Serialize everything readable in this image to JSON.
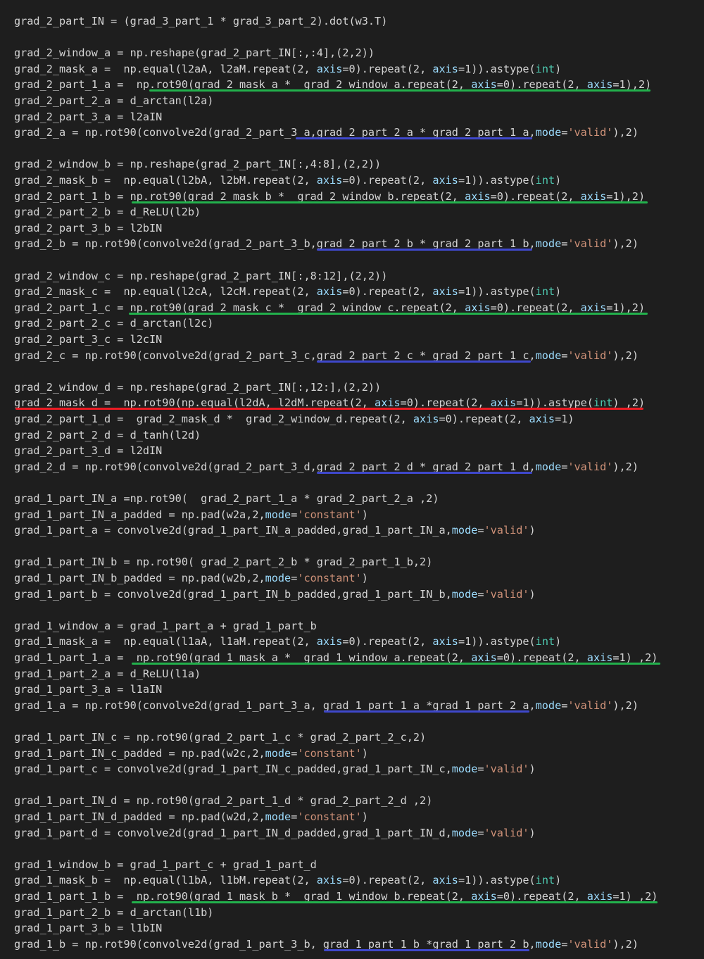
{
  "editor": {
    "colors": {
      "background": "#1e1e1e",
      "text": "#d4d4d4",
      "keyword_arg": "#9cdcfe",
      "string": "#ce9178",
      "number": "#b5cea8",
      "type": "#4ec9b0",
      "underline_green": "#22b14c",
      "underline_blue": "#3f48cc",
      "underline_red": "#ed1c24"
    },
    "lines": [
      [
        [
          "p",
          "grad_2_part_IN = (grad_3_part_1 * grad_3_part_2).dot(w3.T)"
        ]
      ],
      [],
      [
        [
          "p",
          "grad_2_window_a = np.reshape(grad_2_part_IN[:,:4],(2,2))"
        ]
      ],
      [
        [
          "p",
          "grad_2_mask_a =  np.equal(l2aA, l2aM.repeat(2, "
        ],
        [
          "kw",
          "axis"
        ],
        [
          "p",
          "=0).repeat(2, "
        ],
        [
          "kw",
          "axis"
        ],
        [
          "p",
          "=1)).astype("
        ],
        [
          "type",
          "int"
        ],
        [
          "p",
          ")"
        ]
      ],
      [
        [
          "p",
          "grad_2_part_1_a =  np.rot90(grad_2_mask_a *  grad_2_window_a.repeat(2, "
        ],
        [
          "kw",
          "axis"
        ],
        [
          "p",
          "=0).repeat(2, "
        ],
        [
          "kw",
          "axis"
        ],
        [
          "p",
          "=1),2)"
        ]
      ],
      [
        [
          "p",
          "grad_2_part_2_a = d_arctan(l2a)"
        ]
      ],
      [
        [
          "p",
          "grad_2_part_3_a = l2aIN"
        ]
      ],
      [
        [
          "p",
          "grad_2_a = np.rot90(convolve2d(grad_2_part_3_a,grad_2_part_2_a * grad_2_part_1_a,"
        ],
        [
          "kw",
          "mode"
        ],
        [
          "p",
          "="
        ],
        [
          "str",
          "'valid'"
        ],
        [
          "p",
          "),2)"
        ]
      ],
      [],
      [
        [
          "p",
          "grad_2_window_b = np.reshape(grad_2_part_IN[:,4:8],(2,2))"
        ]
      ],
      [
        [
          "p",
          "grad_2_mask_b =  np.equal(l2bA, l2bM.repeat(2, "
        ],
        [
          "kw",
          "axis"
        ],
        [
          "p",
          "=0).repeat(2, "
        ],
        [
          "kw",
          "axis"
        ],
        [
          "p",
          "=1)).astype("
        ],
        [
          "type",
          "int"
        ],
        [
          "p",
          ")"
        ]
      ],
      [
        [
          "p",
          "grad_2_part_1_b = np.rot90(grad_2_mask_b *  grad_2_window_b.repeat(2, "
        ],
        [
          "kw",
          "axis"
        ],
        [
          "p",
          "=0).repeat(2, "
        ],
        [
          "kw",
          "axis"
        ],
        [
          "p",
          "=1),2)"
        ]
      ],
      [
        [
          "p",
          "grad_2_part_2_b = d_ReLU(l2b)"
        ]
      ],
      [
        [
          "p",
          "grad_2_part_3_b = l2bIN"
        ]
      ],
      [
        [
          "p",
          "grad_2_b = np.rot90(convolve2d(grad_2_part_3_b,grad_2_part_2_b * grad_2_part_1_b,"
        ],
        [
          "kw",
          "mode"
        ],
        [
          "p",
          "="
        ],
        [
          "str",
          "'valid'"
        ],
        [
          "p",
          "),2)"
        ]
      ],
      [],
      [
        [
          "p",
          "grad_2_window_c = np.reshape(grad_2_part_IN[:,8:12],(2,2))"
        ]
      ],
      [
        [
          "p",
          "grad_2_mask_c =  np.equal(l2cA, l2cM.repeat(2, "
        ],
        [
          "kw",
          "axis"
        ],
        [
          "p",
          "=0).repeat(2, "
        ],
        [
          "kw",
          "axis"
        ],
        [
          "p",
          "=1)).astype("
        ],
        [
          "type",
          "int"
        ],
        [
          "p",
          ")"
        ]
      ],
      [
        [
          "p",
          "grad_2_part_1_c = np.rot90(grad_2_mask_c *  grad_2_window_c.repeat(2, "
        ],
        [
          "kw",
          "axis"
        ],
        [
          "p",
          "=0).repeat(2, "
        ],
        [
          "kw",
          "axis"
        ],
        [
          "p",
          "=1),2)"
        ]
      ],
      [
        [
          "p",
          "grad_2_part_2_c = d_arctan(l2c)"
        ]
      ],
      [
        [
          "p",
          "grad_2_part_3_c = l2cIN"
        ]
      ],
      [
        [
          "p",
          "grad_2_c = np.rot90(convolve2d(grad_2_part_3_c,grad_2_part_2_c * grad_2_part_1_c,"
        ],
        [
          "kw",
          "mode"
        ],
        [
          "p",
          "="
        ],
        [
          "str",
          "'valid'"
        ],
        [
          "p",
          "),2)"
        ]
      ],
      [],
      [
        [
          "p",
          "grad_2_window_d = np.reshape(grad_2_part_IN[:,12:],(2,2))"
        ]
      ],
      [
        [
          "p",
          "grad_2_mask_d =  np.rot90(np.equal(l2dA, l2dM.repeat(2, "
        ],
        [
          "kw",
          "axis"
        ],
        [
          "p",
          "=0).repeat(2, "
        ],
        [
          "kw",
          "axis"
        ],
        [
          "p",
          "=1)).astype("
        ],
        [
          "type",
          "int"
        ],
        [
          "p",
          ") ,2)"
        ]
      ],
      [
        [
          "p",
          "grad_2_part_1_d =  grad_2_mask_d *  grad_2_window_d.repeat(2, "
        ],
        [
          "kw",
          "axis"
        ],
        [
          "p",
          "=0).repeat(2, "
        ],
        [
          "kw",
          "axis"
        ],
        [
          "p",
          "=1)"
        ]
      ],
      [
        [
          "p",
          "grad_2_part_2_d = d_tanh(l2d)"
        ]
      ],
      [
        [
          "p",
          "grad_2_part_3_d = l2dIN"
        ]
      ],
      [
        [
          "p",
          "grad_2_d = np.rot90(convolve2d(grad_2_part_3_d,grad_2_part_2_d * grad_2_part_1_d,"
        ],
        [
          "kw",
          "mode"
        ],
        [
          "p",
          "="
        ],
        [
          "str",
          "'valid'"
        ],
        [
          "p",
          "),2)"
        ]
      ],
      [],
      [
        [
          "p",
          "grad_1_part_IN_a =np.rot90(  grad_2_part_1_a * grad_2_part_2_a ,2)"
        ]
      ],
      [
        [
          "p",
          "grad_1_part_IN_a_padded = np.pad(w2a,2,"
        ],
        [
          "kw",
          "mode"
        ],
        [
          "p",
          "="
        ],
        [
          "str",
          "'constant'"
        ],
        [
          "p",
          ")"
        ]
      ],
      [
        [
          "p",
          "grad_1_part_a = convolve2d(grad_1_part_IN_a_padded,grad_1_part_IN_a,"
        ],
        [
          "kw",
          "mode"
        ],
        [
          "p",
          "="
        ],
        [
          "str",
          "'valid'"
        ],
        [
          "p",
          ")"
        ]
      ],
      [],
      [
        [
          "p",
          "grad_1_part_IN_b = np.rot90( grad_2_part_2_b * grad_2_part_1_b,2)"
        ]
      ],
      [
        [
          "p",
          "grad_1_part_IN_b_padded = np.pad(w2b,2,"
        ],
        [
          "kw",
          "mode"
        ],
        [
          "p",
          "="
        ],
        [
          "str",
          "'constant'"
        ],
        [
          "p",
          ")"
        ]
      ],
      [
        [
          "p",
          "grad_1_part_b = convolve2d(grad_1_part_IN_b_padded,grad_1_part_IN_b,"
        ],
        [
          "kw",
          "mode"
        ],
        [
          "p",
          "="
        ],
        [
          "str",
          "'valid'"
        ],
        [
          "p",
          ")"
        ]
      ],
      [],
      [
        [
          "p",
          "grad_1_window_a = grad_1_part_a + grad_1_part_b"
        ]
      ],
      [
        [
          "p",
          "grad_1_mask_a =  np.equal(l1aA, l1aM.repeat(2, "
        ],
        [
          "kw",
          "axis"
        ],
        [
          "p",
          "=0).repeat(2, "
        ],
        [
          "kw",
          "axis"
        ],
        [
          "p",
          "=1)).astype("
        ],
        [
          "type",
          "int"
        ],
        [
          "p",
          ")"
        ]
      ],
      [
        [
          "p",
          "grad_1_part_1_a =  np.rot90(grad_1_mask_a *  grad_1_window_a.repeat(2, "
        ],
        [
          "kw",
          "axis"
        ],
        [
          "p",
          "=0).repeat(2, "
        ],
        [
          "kw",
          "axis"
        ],
        [
          "p",
          "=1) ,2)"
        ]
      ],
      [
        [
          "p",
          "grad_1_part_2_a = d_ReLU(l1a)"
        ]
      ],
      [
        [
          "p",
          "grad_1_part_3_a = l1aIN"
        ]
      ],
      [
        [
          "p",
          "grad_1_a = np.rot90(convolve2d(grad_1_part_3_a, grad_1_part_1_a *grad_1_part_2_a,"
        ],
        [
          "kw",
          "mode"
        ],
        [
          "p",
          "="
        ],
        [
          "str",
          "'valid'"
        ],
        [
          "p",
          "),2)"
        ]
      ],
      [],
      [
        [
          "p",
          "grad_1_part_IN_c = np.rot90(grad_2_part_1_c * grad_2_part_2_c,2)"
        ]
      ],
      [
        [
          "p",
          "grad_1_part_IN_c_padded = np.pad(w2c,2,"
        ],
        [
          "kw",
          "mode"
        ],
        [
          "p",
          "="
        ],
        [
          "str",
          "'constant'"
        ],
        [
          "p",
          ")"
        ]
      ],
      [
        [
          "p",
          "grad_1_part_c = convolve2d(grad_1_part_IN_c_padded,grad_1_part_IN_c,"
        ],
        [
          "kw",
          "mode"
        ],
        [
          "p",
          "="
        ],
        [
          "str",
          "'valid'"
        ],
        [
          "p",
          ")"
        ]
      ],
      [],
      [
        [
          "p",
          "grad_1_part_IN_d = np.rot90(grad_2_part_1_d * grad_2_part_2_d ,2)"
        ]
      ],
      [
        [
          "p",
          "grad_1_part_IN_d_padded = np.pad(w2d,2,"
        ],
        [
          "kw",
          "mode"
        ],
        [
          "p",
          "="
        ],
        [
          "str",
          "'constant'"
        ],
        [
          "p",
          ")"
        ]
      ],
      [
        [
          "p",
          "grad_1_part_d = convolve2d(grad_1_part_IN_d_padded,grad_1_part_IN_d,"
        ],
        [
          "kw",
          "mode"
        ],
        [
          "p",
          "="
        ],
        [
          "str",
          "'valid'"
        ],
        [
          "p",
          ")"
        ]
      ],
      [],
      [
        [
          "p",
          "grad_1_window_b = grad_1_part_c + grad_1_part_d"
        ]
      ],
      [
        [
          "p",
          "grad_1_mask_b =  np.equal(l1bA, l1bM.repeat(2, "
        ],
        [
          "kw",
          "axis"
        ],
        [
          "p",
          "=0).repeat(2, "
        ],
        [
          "kw",
          "axis"
        ],
        [
          "p",
          "=1)).astype("
        ],
        [
          "type",
          "int"
        ],
        [
          "p",
          ")"
        ]
      ],
      [
        [
          "p",
          "grad_1_part_1_b =  np.rot90(grad_1_mask_b *  grad_1_window_b.repeat(2, "
        ],
        [
          "kw",
          "axis"
        ],
        [
          "p",
          "=0).repeat(2, "
        ],
        [
          "kw",
          "axis"
        ],
        [
          "p",
          "=1) ,2)"
        ]
      ],
      [
        [
          "p",
          "grad_1_part_2_b = d_arctan(l1b)"
        ]
      ],
      [
        [
          "p",
          "grad_1_part_3_b = l1bIN"
        ]
      ],
      [
        [
          "p",
          "grad_1_b = np.rot90(convolve2d(grad_1_part_3_b, grad_1_part_1_b *grad_1_part_2_b,"
        ],
        [
          "kw",
          "mode"
        ],
        [
          "p",
          "="
        ],
        [
          "str",
          "'valid'"
        ],
        [
          "p",
          "),2)"
        ]
      ]
    ],
    "underlines": [
      {
        "line": 4,
        "color": "green"
      },
      {
        "line": 7,
        "color": "blue"
      },
      {
        "line": 11,
        "color": "green"
      },
      {
        "line": 14,
        "color": "blue"
      },
      {
        "line": 18,
        "color": "green"
      },
      {
        "line": 21,
        "color": "blue"
      },
      {
        "line": 24,
        "color": "red"
      },
      {
        "line": 28,
        "color": "blue"
      },
      {
        "line": 40,
        "color": "green"
      },
      {
        "line": 43,
        "color": "blue"
      },
      {
        "line": 55,
        "color": "green"
      },
      {
        "line": 58,
        "color": "blue"
      }
    ]
  }
}
